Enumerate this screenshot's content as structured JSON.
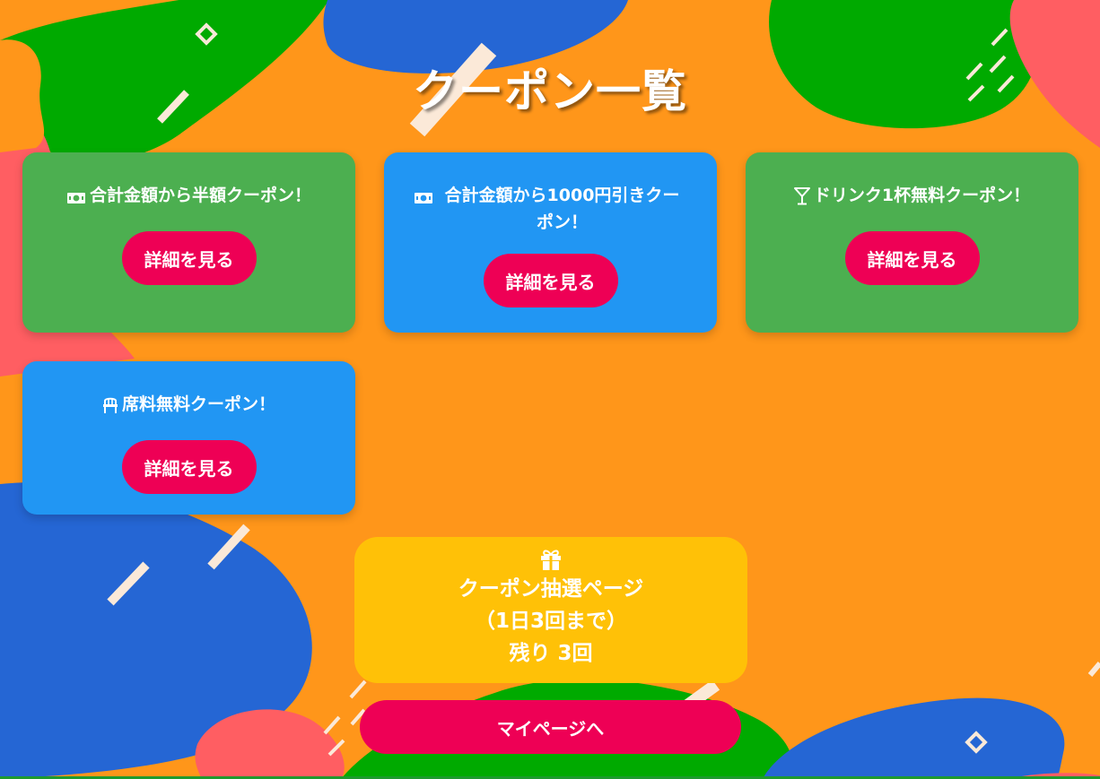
{
  "page": {
    "title": "クーポン一覧"
  },
  "coupons": [
    {
      "title": "合計金額から半額クーポン！",
      "icon": "money-icon",
      "button_label": "詳細を見る",
      "color": "#4CAF50"
    },
    {
      "title": "合計金額から1000円引きクーポン！",
      "icon": "money-icon",
      "button_label": "詳細を見る",
      "color": "#2196F3"
    },
    {
      "title": "ドリンク1杯無料クーポン！",
      "icon": "cocktail-icon",
      "button_label": "詳細を見る",
      "color": "#4CAF50"
    },
    {
      "title": "席料無料クーポン！",
      "icon": "chair-icon",
      "button_label": "詳細を見る",
      "color": "#2196F3"
    }
  ],
  "lottery": {
    "icon": "gift-icon",
    "line1": "クーポン抽選ページ",
    "line2": "（1日3回まで）",
    "line3": "残り 3回",
    "color": "#FFC107"
  },
  "mypage": {
    "label": "マイページへ"
  },
  "colors": {
    "background": "#FF961A",
    "button": "#EE0055",
    "blob_green": "#00AA00",
    "blob_blue": "#2566D4",
    "blob_red": "#FF5E62"
  }
}
